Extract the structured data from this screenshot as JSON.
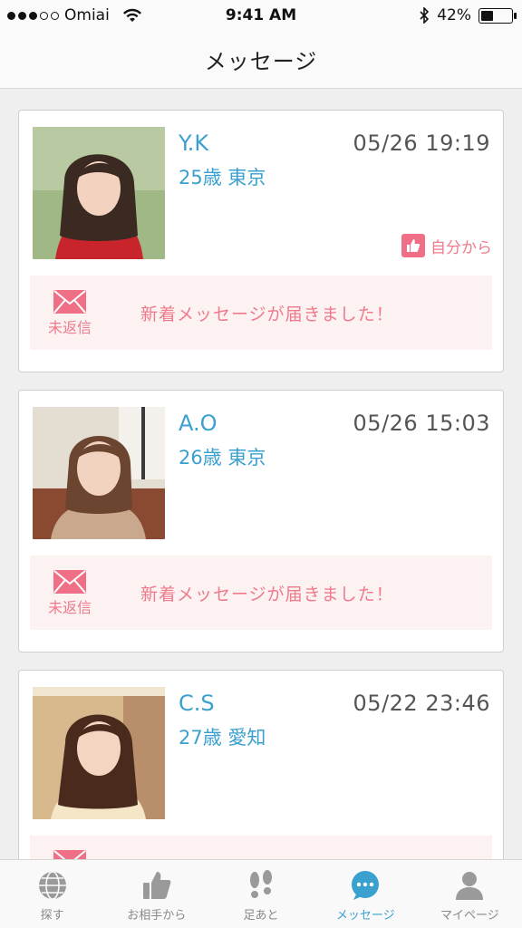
{
  "status_bar": {
    "carrier": "Omiai",
    "time": "9:41 AM",
    "battery": "42%",
    "battery_level": 0.42
  },
  "nav": {
    "title": "メッセージ"
  },
  "colors": {
    "accent_blue": "#3aa0cf",
    "accent_pink": "#ee7a8c",
    "message_bg": "#fdf2f2"
  },
  "conversations": [
    {
      "name": "Y.K",
      "meta": "25歳 東京",
      "date": "05/26 19:19",
      "from_self": "自分から",
      "status": "未返信",
      "message": "新着メッセージが届きました！"
    },
    {
      "name": "A.O",
      "meta": "26歳 東京",
      "date": "05/26 15:03",
      "status": "未返信",
      "message": "新着メッセージが届きました！"
    },
    {
      "name": "C.S",
      "meta": "27歳 愛知",
      "date": "05/22 23:46"
    }
  ],
  "tabs": [
    {
      "label": "探す",
      "icon": "globe-icon"
    },
    {
      "label": "お相手から",
      "icon": "thumbs-up-icon"
    },
    {
      "label": "足あと",
      "icon": "footprints-icon"
    },
    {
      "label": "メッセージ",
      "icon": "chat-bubble-icon",
      "active": true
    },
    {
      "label": "マイページ",
      "icon": "person-icon"
    }
  ]
}
